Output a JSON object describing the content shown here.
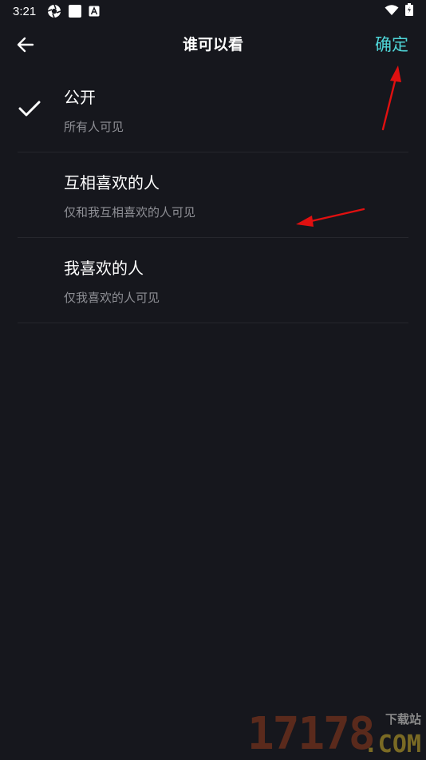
{
  "status_bar": {
    "time": "3:21",
    "icons": [
      "aperture-icon",
      "square-app-icon",
      "a-app-icon",
      "wifi-icon",
      "battery-charging-icon"
    ]
  },
  "header": {
    "title": "谁可以看",
    "confirm_label": "确定",
    "back_icon": "arrow-left-icon"
  },
  "options": [
    {
      "title": "公开",
      "description": "所有人可见",
      "selected": true
    },
    {
      "title": "互相喜欢的人",
      "description": "仅和我互相喜欢的人可见",
      "selected": false
    },
    {
      "title": "我喜欢的人",
      "description": "仅我喜欢的人可见",
      "selected": false
    }
  ],
  "watermark": {
    "number": "17178",
    "label": "下载站",
    "domain": ".COM"
  },
  "colors": {
    "background": "#16171d",
    "accent": "#4fd6d8",
    "annotation_arrow": "#e01010",
    "secondary_text": "#8e8f95",
    "divider": "#26272d"
  }
}
